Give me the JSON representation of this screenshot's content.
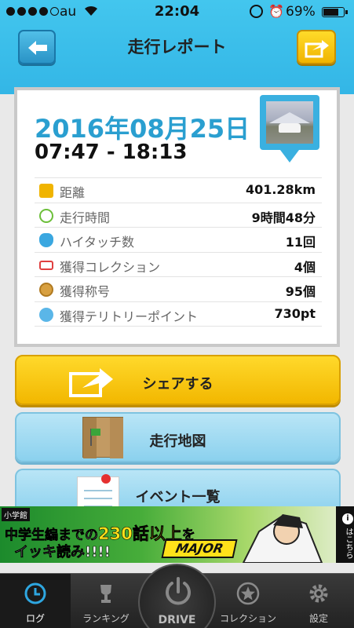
{
  "status_bar": {
    "carrier": "au",
    "time": "22:04",
    "battery": "69%",
    "battery_level": 0.69
  },
  "header": {
    "title": "走行レポート"
  },
  "report": {
    "date": "2016年08月25日",
    "time_range": "07:47 - 18:13",
    "stats": [
      {
        "label": "距離",
        "value": "401.28km",
        "icon": "km-icon",
        "color": "#f0b400"
      },
      {
        "label": "走行時間",
        "value": "9時間48分",
        "icon": "clock-icon",
        "color": "#6cbf3a"
      },
      {
        "label": "ハイタッチ数",
        "value": "11回",
        "icon": "hand-icon",
        "color": "#3aa7e0"
      },
      {
        "label": "獲得コレクション",
        "value": "4個",
        "icon": "car-icon",
        "color": "#e04040"
      },
      {
        "label": "獲得称号",
        "value": "95個",
        "icon": "medal-icon",
        "color": "#d8a040"
      },
      {
        "label": "獲得テリトリーポイント",
        "value": "730pt",
        "icon": "territory-icon",
        "color": "#5ab6e8"
      }
    ]
  },
  "buttons": {
    "share": "シェアする",
    "map": "走行地図",
    "events": "イベント一覧"
  },
  "ad": {
    "publisher": "小学館",
    "line1_a": "中学生編までの",
    "line1_b": "230話以上",
    "line1_c": "を",
    "line2": "イッキ読み!!!!",
    "logo": "MAJOR",
    "side": "はこちら"
  },
  "tabs": {
    "log": "ログ",
    "ranking": "ランキング",
    "drive": "DRIVE",
    "collection": "コレクション",
    "settings": "設定"
  }
}
